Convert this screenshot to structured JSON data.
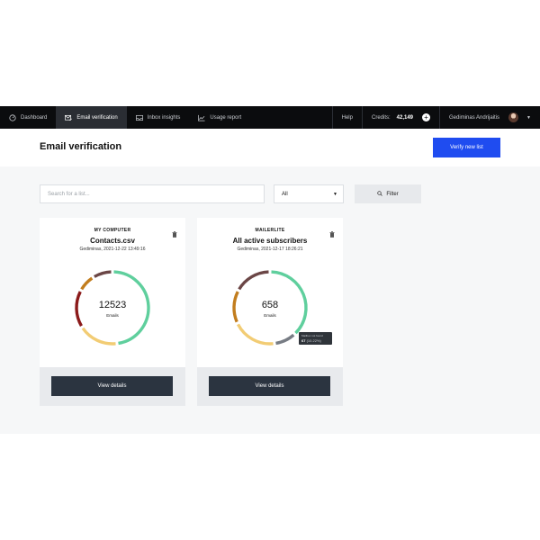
{
  "nav": {
    "items": [
      {
        "label": "Dashboard",
        "icon": "gauge-icon",
        "active": false
      },
      {
        "label": "Email verification",
        "icon": "envelope-check-icon",
        "active": true
      },
      {
        "label": "Inbox insights",
        "icon": "inbox-icon",
        "active": false
      },
      {
        "label": "Usage report",
        "icon": "chart-line-icon",
        "active": false
      }
    ],
    "help": "Help",
    "credits_label": "Credits:",
    "credits_value": "42,149",
    "user_name": "Gediminas Andrijaitis"
  },
  "header": {
    "title": "Email verification",
    "verify_button": "Verify new list"
  },
  "filters": {
    "search_placeholder": "Search for a list...",
    "select_value": "All",
    "filter_button": "Filter"
  },
  "cards": [
    {
      "source": "MY COMPUTER",
      "name": "Contacts.csv",
      "meta": "Gediminas, 2021-12-22 13:49:16",
      "total": "12523",
      "total_label": "Emails",
      "view_button": "View details",
      "segments": [
        {
          "color": "#5fcf9d",
          "fraction": 0.48
        },
        {
          "color": "#f2cc74",
          "fraction": 0.18
        },
        {
          "color": "#8b1a1a",
          "fraction": 0.17
        },
        {
          "color": "#c27d1e",
          "fraction": 0.08
        },
        {
          "color": "#6b4646",
          "fraction": 0.09
        }
      ]
    },
    {
      "source": "MAILERLITE",
      "name": "All active subscribers",
      "meta": "Gediminas, 2021-12-17 18:26:21",
      "total": "658",
      "total_label": "Emails",
      "view_button": "View details",
      "segments": [
        {
          "color": "#5fcf9d",
          "fraction": 0.38
        },
        {
          "color": "#777c84",
          "fraction": 0.1
        },
        {
          "color": "#f2cc74",
          "fraction": 0.2
        },
        {
          "color": "#c27d1e",
          "fraction": 0.15
        },
        {
          "color": "#6b4646",
          "fraction": 0.17
        }
      ],
      "tooltip": {
        "title": "Mailbox not found",
        "count": "67",
        "pct": "(10.22%)"
      }
    }
  ]
}
